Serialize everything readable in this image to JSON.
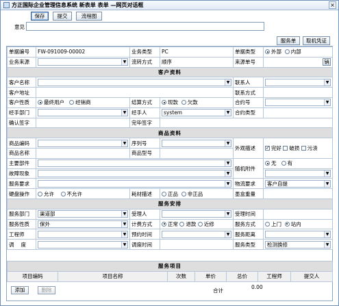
{
  "window": {
    "title": "方正国际企业管理信息系统 新表单 表单 —网页对话框",
    "close": "×"
  },
  "toolbar": {
    "save": "保存",
    "submit": "提交",
    "flow": "流程图"
  },
  "opinion": {
    "label": "意见"
  },
  "topbtns": {
    "service_order": "服务单",
    "retrieve": "取机凭证"
  },
  "basic": {
    "doc_no_label": "单据编号",
    "doc_no": "FW-091009-00002",
    "biz_type_label": "业务类型",
    "biz_type": "PC",
    "doc_type_label": "单据类型",
    "ext": "外部",
    "int": "内部",
    "source_label": "业务来源",
    "flow_label": "流转方式",
    "flow": "顺序",
    "src_no_label": "来源单号",
    "src_btn": "销"
  },
  "customer": {
    "section": "客户资料",
    "name_label": "客户名称",
    "contact_label": "联系人",
    "addr_label": "客户地址",
    "contact_way_label": "联系方式",
    "nature_label": "客户性质",
    "final_user": "最终用户",
    "dealer": "经销商",
    "settle_label": "结算方式",
    "cash": "现款",
    "credit": "欠款",
    "contract_label": "合约号",
    "dept_label": "经手部门",
    "handler_label": "经手人",
    "handler": "system",
    "contract_type_label": "合约类型",
    "confirm_label": "确认签字",
    "done_label": "完毕签字"
  },
  "product": {
    "section": "商品资料",
    "code_label": "商品编码",
    "serial_label": "序列号",
    "appearance_label": "外观描述",
    "intact": "完好",
    "broken": "破损",
    "dirty": "污渍",
    "name_label": "商品名称",
    "model_label": "商品型号",
    "parts_label": "主要部件",
    "attach_label": "随机附件",
    "none": "无",
    "has": "有",
    "fault_label": "故障现象",
    "req_label": "服务要求",
    "logistics_label": "物流要求",
    "self_pick": "客户自提",
    "hdd_label": "硬盘操作",
    "allow": "允许",
    "disallow": "不允许",
    "consume_label": "耗材描述",
    "genuine": "正品",
    "nongenuine": "非正品",
    "ink_label": "墨盒重量"
  },
  "service": {
    "section": "服务安排",
    "dept_label": "服务部门",
    "dept": "渠道部",
    "receiver_label": "受理人",
    "recv_time_label": "受理时间",
    "nature_label": "服务性质",
    "nature": "保外",
    "fee_label": "计费方式",
    "normal": "正常",
    "refund": "退款",
    "nearby": "近修",
    "mode_label": "服务方式",
    "onsite": "上门",
    "station": "站内",
    "engineer_label": "工程师",
    "appoint_label": "预约时间",
    "distance_label": "服务距离",
    "dispatch_label": "调度",
    "dispatch_time_label": "调度时间",
    "stype_label": "服务类型",
    "stype": "检测换修"
  },
  "items": {
    "section": "服务项目",
    "cols": [
      "项目编码",
      "项目名称",
      "次数",
      "单价",
      "总价",
      "工程师",
      "提交人"
    ],
    "total_label": "合计",
    "total": "0.00",
    "add": "添加",
    "delete": "删除"
  }
}
